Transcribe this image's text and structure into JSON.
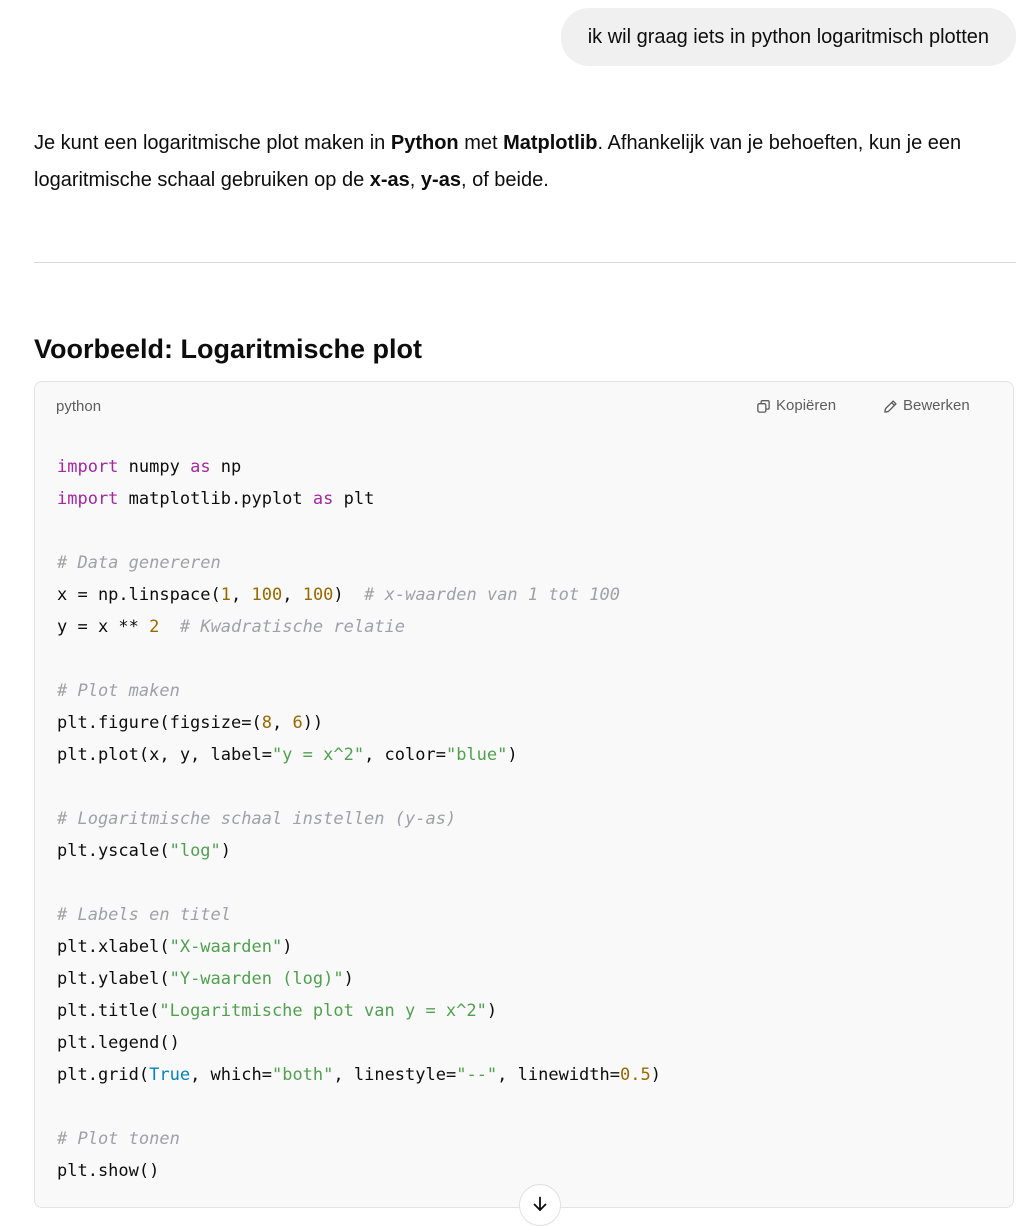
{
  "user_message": "ik wil graag iets in python logaritmisch plotten",
  "answer": {
    "p1": "Je kunt een logaritmische plot maken in ",
    "b1": "Python",
    "p2": " met ",
    "b2": "Matplotlib",
    "p3": ". Afhankelijk van je behoeften, kun je een logaritmische schaal gebruiken op de ",
    "b3": "x-as",
    "p4": ", ",
    "b4": "y-as",
    "p5": ", of beide."
  },
  "heading": "Voorbeeld: Logaritmische plot",
  "code_block": {
    "language": "python",
    "copy_label": "Kopiëren",
    "edit_label": "Bewerken",
    "lines": [
      [
        {
          "t": "kw",
          "v": "import"
        },
        {
          "t": "",
          "v": " numpy "
        },
        {
          "t": "kw",
          "v": "as"
        },
        {
          "t": "",
          "v": " np"
        }
      ],
      [
        {
          "t": "kw",
          "v": "import"
        },
        {
          "t": "",
          "v": " matplotlib.pyplot "
        },
        {
          "t": "kw",
          "v": "as"
        },
        {
          "t": "",
          "v": " plt"
        }
      ],
      [],
      [
        {
          "t": "com",
          "v": "# Data genereren"
        }
      ],
      [
        {
          "t": "",
          "v": "x = np.linspace("
        },
        {
          "t": "num",
          "v": "1"
        },
        {
          "t": "",
          "v": ", "
        },
        {
          "t": "num",
          "v": "100"
        },
        {
          "t": "",
          "v": ", "
        },
        {
          "t": "num",
          "v": "100"
        },
        {
          "t": "",
          "v": ")  "
        },
        {
          "t": "com",
          "v": "# x-waarden van 1 tot 100"
        }
      ],
      [
        {
          "t": "",
          "v": "y = x ** "
        },
        {
          "t": "num",
          "v": "2"
        },
        {
          "t": "",
          "v": "  "
        },
        {
          "t": "com",
          "v": "# Kwadratische relatie"
        }
      ],
      [],
      [
        {
          "t": "com",
          "v": "# Plot maken"
        }
      ],
      [
        {
          "t": "",
          "v": "plt.figure(figsize=("
        },
        {
          "t": "num",
          "v": "8"
        },
        {
          "t": "",
          "v": ", "
        },
        {
          "t": "num",
          "v": "6"
        },
        {
          "t": "",
          "v": "))"
        }
      ],
      [
        {
          "t": "",
          "v": "plt.plot(x, y, label="
        },
        {
          "t": "str",
          "v": "\"y = x^2\""
        },
        {
          "t": "",
          "v": ", color="
        },
        {
          "t": "str",
          "v": "\"blue\""
        },
        {
          "t": "",
          "v": ")"
        }
      ],
      [],
      [
        {
          "t": "com",
          "v": "# Logaritmische schaal instellen (y-as)"
        }
      ],
      [
        {
          "t": "",
          "v": "plt.yscale("
        },
        {
          "t": "str",
          "v": "\"log\""
        },
        {
          "t": "",
          "v": ")"
        }
      ],
      [],
      [
        {
          "t": "com",
          "v": "# Labels en titel"
        }
      ],
      [
        {
          "t": "",
          "v": "plt.xlabel("
        },
        {
          "t": "str",
          "v": "\"X-waarden\""
        },
        {
          "t": "",
          "v": ")"
        }
      ],
      [
        {
          "t": "",
          "v": "plt.ylabel("
        },
        {
          "t": "str",
          "v": "\"Y-waarden (log)\""
        },
        {
          "t": "",
          "v": ")"
        }
      ],
      [
        {
          "t": "",
          "v": "plt.title("
        },
        {
          "t": "str",
          "v": "\"Logaritmische plot van y = x^2\""
        },
        {
          "t": "",
          "v": ")"
        }
      ],
      [
        {
          "t": "",
          "v": "plt.legend()"
        }
      ],
      [
        {
          "t": "",
          "v": "plt.grid("
        },
        {
          "t": "bool",
          "v": "True"
        },
        {
          "t": "",
          "v": ", which="
        },
        {
          "t": "str",
          "v": "\"both\""
        },
        {
          "t": "",
          "v": ", linestyle="
        },
        {
          "t": "str",
          "v": "\"--\""
        },
        {
          "t": "",
          "v": ", linewidth="
        },
        {
          "t": "num",
          "v": "0.5"
        },
        {
          "t": "",
          "v": ")"
        }
      ],
      [],
      [
        {
          "t": "com",
          "v": "# Plot tonen"
        }
      ],
      [
        {
          "t": "",
          "v": "plt.show()"
        }
      ]
    ]
  },
  "icons": {
    "copy": "copy-icon",
    "edit": "pencil-icon",
    "scroll": "arrow-down-icon"
  },
  "colors": {
    "keyword": "#a626a4",
    "number": "#986801",
    "string": "#50a14f",
    "comment": "#a0a1a7",
    "boolean": "#0184bc"
  }
}
